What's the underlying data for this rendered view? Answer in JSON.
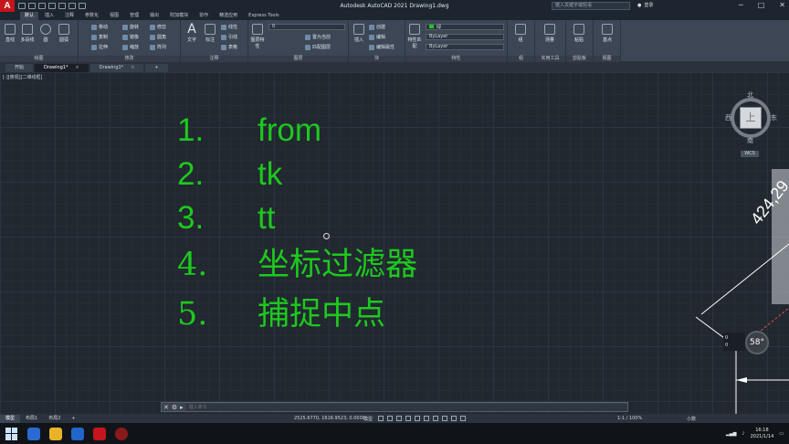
{
  "titlebar": {
    "app_logo": "A",
    "title": "Autodesk AutoCAD 2021    Drawing1.dwg",
    "search_placeholder": "键入关键字或短语",
    "login_label": "登录"
  },
  "ribbon_tabs": [
    "默认",
    "插入",
    "注释",
    "参数化",
    "视图",
    "管理",
    "输出",
    "附加模块",
    "协作",
    "精选应用",
    "Express Tools"
  ],
  "ribbon_groups": {
    "draw": {
      "label": "绘图",
      "line": "直线",
      "polyline": "多段线",
      "circle": "圆",
      "arc": "圆弧"
    },
    "modify": {
      "label": "修改",
      "move": "移动",
      "rotate": "旋转",
      "trim": "修剪",
      "copy": "复制",
      "mirror": "镜像",
      "fillet": "圆角",
      "stretch": "拉伸",
      "scale": "缩放",
      "array": "阵列"
    },
    "annotation": {
      "label": "注释",
      "text": "文字",
      "dimension": "标注",
      "linear": "线性",
      "leader": "引线",
      "table": "表格"
    },
    "layers": {
      "label": "图层",
      "properties": "图层特性",
      "layer_value": "0",
      "set_current": "置为当前",
      "match": "匹配图层"
    },
    "block": {
      "label": "块",
      "insert": "插入",
      "create": "创建",
      "edit": "编辑",
      "edit_attr": "编辑属性"
    },
    "properties": {
      "label": "特性",
      "match": "特性匹配",
      "color": "绿",
      "linetype": "ByLayer",
      "lineweight": "ByLayer"
    },
    "groups": {
      "label": "组",
      "group": "组"
    },
    "utilities": {
      "label": "实用工具",
      "measure": "测量"
    },
    "clipboard": {
      "label": "剪贴板",
      "paste": "粘贴"
    },
    "view": {
      "label": "视图",
      "base": "基点"
    }
  },
  "doc_tabs": [
    {
      "label": "开始",
      "active": false
    },
    {
      "label": "Drawing1*",
      "active": true
    },
    {
      "label": "Drawing1*",
      "active": false
    }
  ],
  "viewport_label": "[-][俯视][二维线框]",
  "steps": [
    {
      "num": "1.",
      "text": "from"
    },
    {
      "num": "2.",
      "text": "tk"
    },
    {
      "num": "3.",
      "text": "tt"
    },
    {
      "num": "4.",
      "text": "坐标过滤器"
    },
    {
      "num": "5.",
      "text": "捕捉中点"
    }
  ],
  "viewcube": {
    "north": "北",
    "south": "南",
    "east": "东",
    "west": "西",
    "top": "上",
    "wcs": "WCS"
  },
  "dimension_text": "424,29",
  "snap_readout": {
    "a": "0",
    "b": "0"
  },
  "angle_readout": "58°",
  "command_line": {
    "placeholder": "键入命令"
  },
  "layout_tabs": [
    {
      "label": "模型",
      "active": true
    },
    {
      "label": "布局1",
      "active": false
    },
    {
      "label": "布局2",
      "active": false
    }
  ],
  "status": {
    "coords": "2525.6770, 1616.9523, 0.0000",
    "model": "模型",
    "scale": "1:1 / 100%",
    "units": "小数"
  },
  "taskbar": {
    "time": "16:18",
    "date": "2021/1/14"
  },
  "colors": {
    "text_green": "#1ec81e",
    "canvas_bg": "#212830",
    "ribbon_bg": "#3c4654"
  }
}
